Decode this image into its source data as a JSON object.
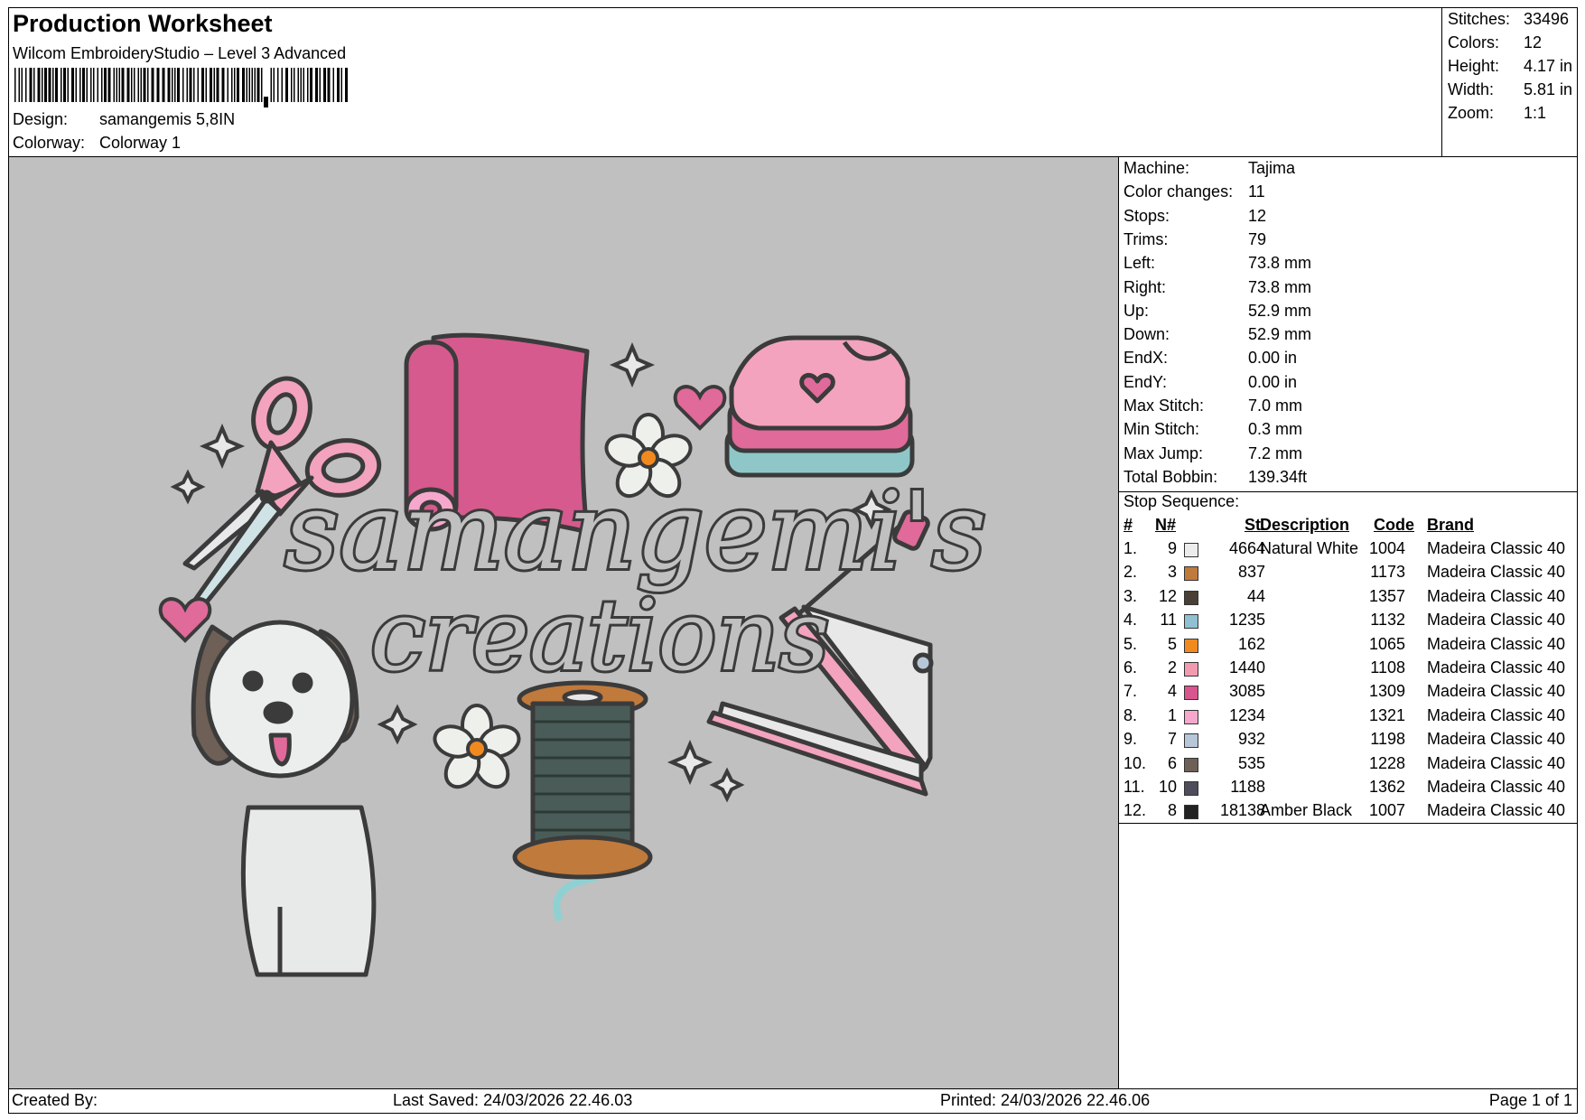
{
  "header": {
    "title": "Production Worksheet",
    "software": "Wilcom EmbroideryStudio – Level 3 Advanced",
    "design_label": "Design:",
    "design_value": "samangemis 5,8IN",
    "colorway_label": "Colorway:",
    "colorway_value": "Colorway 1"
  },
  "summary": [
    {
      "label": "Stitches:",
      "value": "33496"
    },
    {
      "label": "Colors:",
      "value": "12"
    },
    {
      "label": "Height:",
      "value": "4.17 in"
    },
    {
      "label": "Width:",
      "value": "5.81 in"
    },
    {
      "label": "Zoom:",
      "value": "1:1"
    }
  ],
  "machine": [
    {
      "label": "Machine:",
      "value": "Tajima"
    },
    {
      "label": "Color changes:",
      "value": "11"
    },
    {
      "label": "Stops:",
      "value": "12"
    },
    {
      "label": "Trims:",
      "value": "79"
    },
    {
      "label": "Left:",
      "value": "73.8 mm"
    },
    {
      "label": "Right:",
      "value": "73.8 mm"
    },
    {
      "label": "Up:",
      "value": "52.9 mm"
    },
    {
      "label": "Down:",
      "value": "52.9 mm"
    },
    {
      "label": "EndX:",
      "value": "0.00 in"
    },
    {
      "label": "EndY:",
      "value": "0.00 in"
    },
    {
      "label": "Max Stitch:",
      "value": "7.0 mm"
    },
    {
      "label": "Min Stitch:",
      "value": "0.3 mm"
    },
    {
      "label": "Max Jump:",
      "value": "7.2 mm"
    },
    {
      "label": "Total Bobbin:",
      "value": "139.34ft"
    }
  ],
  "stop_sequence": {
    "label": "Stop Sequence:",
    "headers": {
      "num": "#",
      "n": "N#",
      "st": "St.",
      "desc": "Description",
      "code": "Code",
      "brand": "Brand"
    },
    "rows": [
      {
        "num": "1.",
        "n": "9",
        "color": "#ececec",
        "st": "4664",
        "desc": "Natural White",
        "code": "1004",
        "brand": "Madeira Classic 40"
      },
      {
        "num": "2.",
        "n": "3",
        "color": "#c07a3c",
        "st": "837",
        "desc": "",
        "code": "1173",
        "brand": "Madeira Classic 40"
      },
      {
        "num": "3.",
        "n": "12",
        "color": "#4a3f35",
        "st": "44",
        "desc": "",
        "code": "1357",
        "brand": "Madeira Classic 40"
      },
      {
        "num": "4.",
        "n": "11",
        "color": "#8fc1d3",
        "st": "1235",
        "desc": "",
        "code": "1132",
        "brand": "Madeira Classic 40"
      },
      {
        "num": "5.",
        "n": "5",
        "color": "#f08a1e",
        "st": "162",
        "desc": "",
        "code": "1065",
        "brand": "Madeira Classic 40"
      },
      {
        "num": "6.",
        "n": "2",
        "color": "#f29bb0",
        "st": "1440",
        "desc": "",
        "code": "1108",
        "brand": "Madeira Classic 40"
      },
      {
        "num": "7.",
        "n": "4",
        "color": "#d9558d",
        "st": "3085",
        "desc": "",
        "code": "1309",
        "brand": "Madeira Classic 40"
      },
      {
        "num": "8.",
        "n": "1",
        "color": "#f5a8cc",
        "st": "1234",
        "desc": "",
        "code": "1321",
        "brand": "Madeira Classic 40"
      },
      {
        "num": "9.",
        "n": "7",
        "color": "#b7c6d8",
        "st": "932",
        "desc": "",
        "code": "1198",
        "brand": "Madeira Classic 40"
      },
      {
        "num": "10.",
        "n": "6",
        "color": "#6e6056",
        "st": "535",
        "desc": "",
        "code": "1228",
        "brand": "Madeira Classic 40"
      },
      {
        "num": "11.",
        "n": "10",
        "color": "#4e4d5c",
        "st": "1188",
        "desc": "",
        "code": "1362",
        "brand": "Madeira Classic 40"
      },
      {
        "num": "12.",
        "n": "8",
        "color": "#222222",
        "st": "18138",
        "desc": "Amber Black",
        "code": "1007",
        "brand": "Madeira Classic 40"
      }
    ]
  },
  "design": {
    "line1": "samangemi's",
    "line2": "creations"
  },
  "footer": {
    "created_by": "Created By:",
    "last_saved": "Last Saved: 24/03/2026 22.46.03",
    "printed": "Printed: 24/03/2026 22.46.06",
    "page": "Page 1 of 1"
  }
}
